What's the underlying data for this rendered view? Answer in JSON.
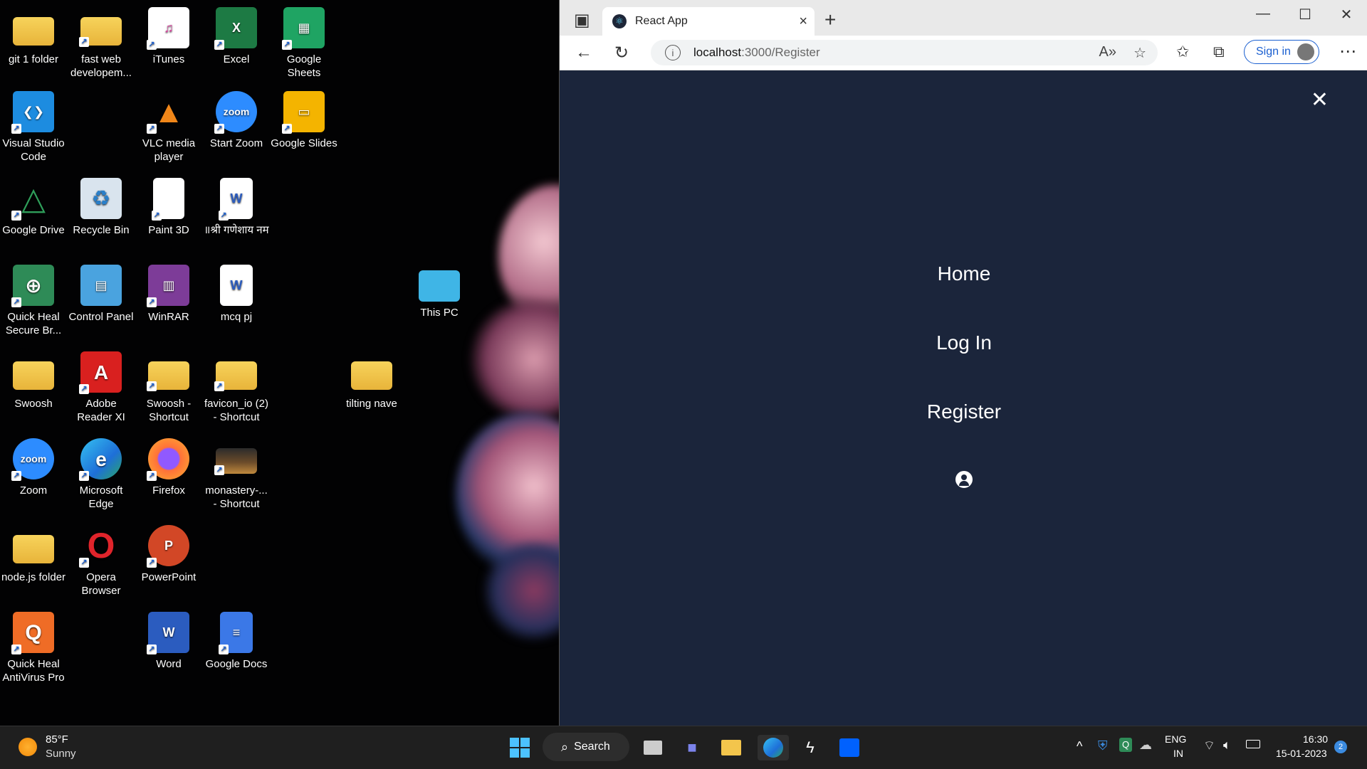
{
  "desktop": {
    "icons": [
      {
        "label": "git 1 folder",
        "icon": "folder-icon",
        "color": "#f3c54c",
        "glyph": ""
      },
      {
        "label": "fast web developem...",
        "icon": "folder-icon",
        "color": "#f3c54c",
        "glyph": ""
      },
      {
        "label": "iTunes",
        "icon": "itunes-icon",
        "color": "#ffffff",
        "glyph": "♫"
      },
      {
        "label": "Excel",
        "icon": "excel-icon",
        "color": "#1d7a44",
        "glyph": "X"
      },
      {
        "label": "Google Sheets",
        "icon": "google-sheets-icon",
        "color": "#1fa463",
        "glyph": "▦"
      },
      {
        "label": "Visual Studio Code",
        "icon": "vscode-icon",
        "color": "#1d8ce0",
        "glyph": "❮❯"
      },
      {
        "label": "VLC media player",
        "icon": "vlc-icon",
        "color": "#f08619",
        "glyph": "▲"
      },
      {
        "label": "Start Zoom",
        "icon": "zoom-icon",
        "color": "#2d8cff",
        "glyph": "zoom"
      },
      {
        "label": "Google Slides",
        "icon": "google-slides-icon",
        "color": "#f4b400",
        "glyph": "▭"
      },
      {
        "label": "Google Drive",
        "icon": "google-drive-icon",
        "color": "#2f9e5a",
        "glyph": "△"
      },
      {
        "label": "Recycle Bin",
        "icon": "recycle-bin-icon",
        "color": "#d9e4ee",
        "glyph": "♻"
      },
      {
        "label": "Paint 3D",
        "icon": "paint3d-icon",
        "color": "#ffffff",
        "glyph": ""
      },
      {
        "label": "॥श्री गणेशाय नम",
        "icon": "word-doc-icon",
        "color": "#ffffff",
        "glyph": "W"
      },
      {
        "label": "Quick Heal Secure Br...",
        "icon": "quickheal-browser-icon",
        "color": "#2e8b57",
        "glyph": "⊕"
      },
      {
        "label": "Control Panel",
        "icon": "control-panel-icon",
        "color": "#4aa3df",
        "glyph": "▤"
      },
      {
        "label": "WinRAR",
        "icon": "winrar-icon",
        "color": "#7d3c98",
        "glyph": "▥"
      },
      {
        "label": "mcq pj",
        "icon": "word-doc-icon",
        "color": "#ffffff",
        "glyph": "W"
      },
      {
        "label": "This PC",
        "icon": "this-pc-icon",
        "color": "#3fb5e6",
        "glyph": "▬"
      },
      {
        "label": "Swoosh",
        "icon": "folder-icon",
        "color": "#f3c54c",
        "glyph": ""
      },
      {
        "label": "Adobe Reader XI",
        "icon": "adobe-reader-icon",
        "color": "#d9201f",
        "glyph": "A"
      },
      {
        "label": "Swoosh - Shortcut",
        "icon": "folder-icon",
        "color": "#f3c54c",
        "glyph": ""
      },
      {
        "label": "favicon_io (2) - Shortcut",
        "icon": "zip-folder-icon",
        "color": "#f3c54c",
        "glyph": ""
      },
      {
        "label": "tilting nave",
        "icon": "folder-icon",
        "color": "#f3c54c",
        "glyph": ""
      },
      {
        "label": "Zoom",
        "icon": "zoom-icon",
        "color": "#2d8cff",
        "glyph": "zoom"
      },
      {
        "label": "Microsoft Edge",
        "icon": "edge-icon",
        "color": "#1e8fd8",
        "glyph": "e"
      },
      {
        "label": "Firefox",
        "icon": "firefox-icon",
        "color": "#ff7139",
        "glyph": "◉"
      },
      {
        "label": "monastery-... - Shortcut",
        "icon": "image-file-icon",
        "color": "#6b4b2a",
        "glyph": ""
      },
      {
        "label": "node.js folder",
        "icon": "folder-icon",
        "color": "#f3c54c",
        "glyph": ""
      },
      {
        "label": "Opera Browser",
        "icon": "opera-icon",
        "color": "#e0242b",
        "glyph": "O"
      },
      {
        "label": "PowerPoint",
        "icon": "powerpoint-icon",
        "color": "#d24726",
        "glyph": "P"
      },
      {
        "label": "Quick Heal AntiVirus Pro",
        "icon": "quickheal-icon",
        "color": "#ef6c26",
        "glyph": "Q"
      },
      {
        "label": "Word",
        "icon": "word-icon",
        "color": "#2b5cbf",
        "glyph": "W"
      },
      {
        "label": "Google Docs",
        "icon": "google-docs-icon",
        "color": "#3b78e7",
        "glyph": "≡"
      }
    ]
  },
  "browser": {
    "tab_title": "React App",
    "url_host": "localhost",
    "url_path": ":3000/Register",
    "signin_label": "Sign in",
    "page": {
      "menu": [
        "Home",
        "Log In",
        "Register"
      ]
    }
  },
  "taskbar": {
    "weather_temp": "85°F",
    "weather_desc": "Sunny",
    "search_label": "Search",
    "lang_top": "ENG",
    "lang_bottom": "IN",
    "time": "16:30",
    "date": "15-01-2023",
    "notification_count": "2"
  }
}
